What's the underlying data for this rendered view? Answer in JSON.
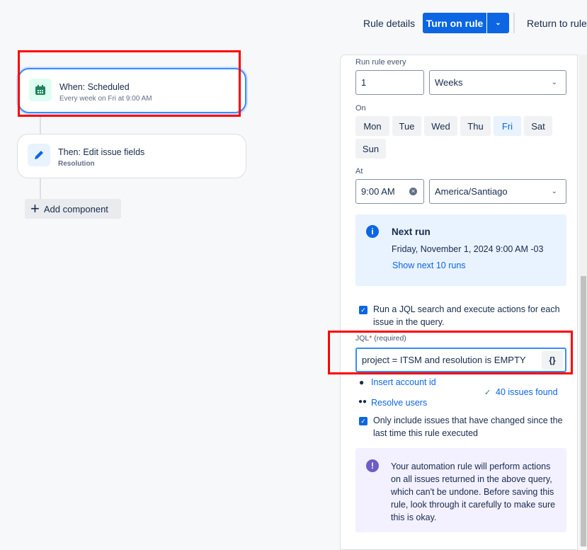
{
  "header": {
    "rule_details": "Rule details",
    "turn_on": "Turn on rule",
    "return": "Return to rules"
  },
  "flow": {
    "trigger": {
      "title": "When: Scheduled",
      "subtitle": "Every week on Fri at 9:00 AM",
      "icon": "calendar-icon"
    },
    "action": {
      "title": "Then: Edit issue fields",
      "subtitle": "Resolution",
      "icon": "pencil-icon"
    },
    "add_component": "Add component"
  },
  "panel": {
    "run_every_label": "Run rule every",
    "run_every_value": "1",
    "run_every_unit": "Weeks",
    "on_label": "On",
    "days": [
      "Mon",
      "Tue",
      "Wed",
      "Thu",
      "Fri",
      "Sat",
      "Sun"
    ],
    "selected_day": "Fri",
    "at_label": "At",
    "time": "9:00 AM",
    "timezone": "America/Santiago",
    "next_run": {
      "title": "Next run",
      "value": "Friday, November 1, 2024 9:00 AM -03",
      "link": "Show next 10 runs"
    },
    "jql_checkbox": "Run a JQL search and execute actions for each issue in the query.",
    "jql_label": "JQL",
    "jql_required": "* ",
    "jql_required_hint": "(required)",
    "jql_value": "project = ITSM and resolution is EMPTY",
    "jql_button": "{}",
    "insert_account": "Insert account id",
    "resolve_users": "Resolve users",
    "issues_found": "40 issues found",
    "only_changed": "Only include issues that have changed since the last time this rule executed",
    "warning": "Your automation rule will perform actions on all issues returned in the above query, which can't be undone. Before saving this rule, look through it carefully to make sure this is okay."
  },
  "colors": {
    "accent": "#0c66e4",
    "trigger_icon": "#1f845a",
    "warning_icon": "#6e5dc6"
  }
}
